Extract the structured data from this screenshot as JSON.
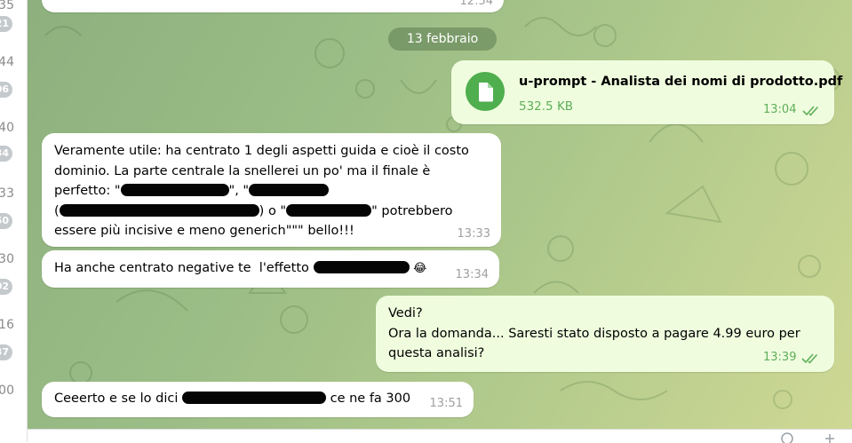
{
  "sidebar": {
    "rows": [
      {
        "time": "35",
        "badge": "21"
      },
      {
        "time": "44",
        "badge": "06"
      },
      {
        "time": "40",
        "badge": "34"
      },
      {
        "time": "33",
        "badge": "50"
      },
      {
        "time": "30",
        "badge": "02"
      },
      {
        "time": "16",
        "badge": "37"
      },
      {
        "time": "00",
        "badge": ""
      }
    ]
  },
  "chat": {
    "top_partial_time": "12:54",
    "date_separator": "13 febbraio",
    "file_message": {
      "name": "u-prompt - Analista dei nomi di prodotto.pdf",
      "size": "532.5 KB",
      "time": "13:04",
      "read_status": "double-check"
    },
    "messages": [
      {
        "direction": "incoming",
        "line1": "Veramente utile: ha centrato 1 degli aspetti guida e cioè il costo",
        "line2": "dominio. La parte centrale la snellerei un po' ma il finale è",
        "line3_a": "perfetto: \"",
        "line3_b": "\", \"",
        "line4_a": "(",
        "line4_b": ") o \"",
        "line4_c": "\" potrebbero",
        "line5": "essere più incisive e meno generich\"\"\" bello!!!",
        "time": "13:33"
      },
      {
        "direction": "incoming",
        "text_a": "Ha anche centrato negative te  l'effetto ",
        "emoji": "😂",
        "time": "13:34"
      },
      {
        "direction": "outgoing",
        "line1": "Vedi?",
        "line2": "Ora la domanda... Saresti stato disposto a pagare 4.99 euro per",
        "line3": "questa analisi?",
        "time": "13:39",
        "read_status": "double-check"
      },
      {
        "direction": "incoming",
        "text_a": "Ceeerto e se lo dici ",
        "text_b": " ce ne fa 300",
        "time": "13:51"
      }
    ]
  },
  "colors": {
    "outgoing_bubble": "#effdde",
    "incoming_bubble": "#ffffff",
    "accent_green": "#4fae4e",
    "time_green": "#5fae5a",
    "date_pill": "#5b7c50"
  },
  "icons": [
    "file-icon",
    "double-check-icon",
    "smiley-icon",
    "send-icon"
  ]
}
